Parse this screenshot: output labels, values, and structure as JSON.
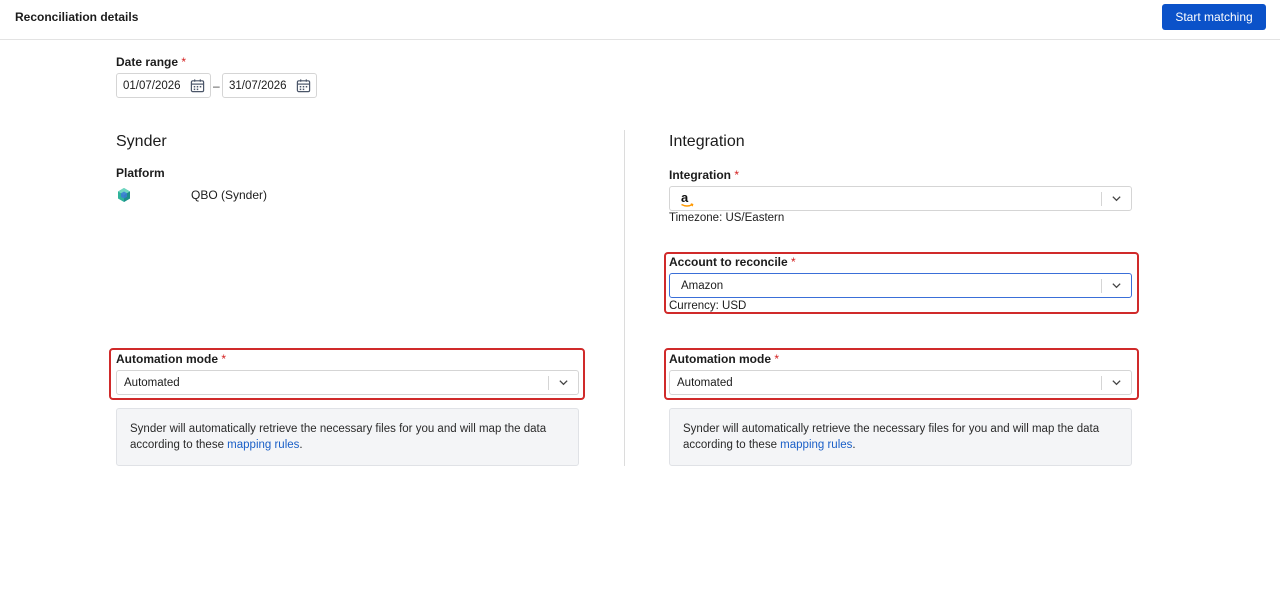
{
  "header": {
    "title": "Reconciliation details",
    "start_button": "Start matching"
  },
  "date_range": {
    "label": "Date range",
    "required": "*",
    "start": "01/07/2026",
    "separator": "–",
    "end": "31/07/2026",
    "icon": "calendar-icon"
  },
  "synder": {
    "title": "Synder",
    "platform_label": "Platform",
    "platform_value": "QBO (Synder)",
    "platform_icon": "synder-logo-icon",
    "automation_label": "Automation mode",
    "required": "*",
    "automation_value": "Automated",
    "info_text": "Synder will automatically retrieve the necessary files for you and will map the data according to these",
    "info_link": "mapping rules",
    "info_end": "."
  },
  "integration": {
    "title": "Integration",
    "integration_label": "Integration",
    "required": "*",
    "integration_icon": "amazon-logo-icon",
    "timezone": "Timezone: US/Eastern",
    "account_label": "Account to reconcile",
    "account_value": "Amazon",
    "currency": "Currency: USD",
    "automation_label": "Automation mode",
    "automation_value": "Automated",
    "info_text": "Synder will automatically retrieve the necessary files for you and will map the data according to these",
    "info_link": "mapping rules",
    "info_end": "."
  },
  "colors": {
    "primary": "#0b52c9",
    "required": "#d32020",
    "highlight": "#d02a2a",
    "link": "#1a5fc7"
  }
}
